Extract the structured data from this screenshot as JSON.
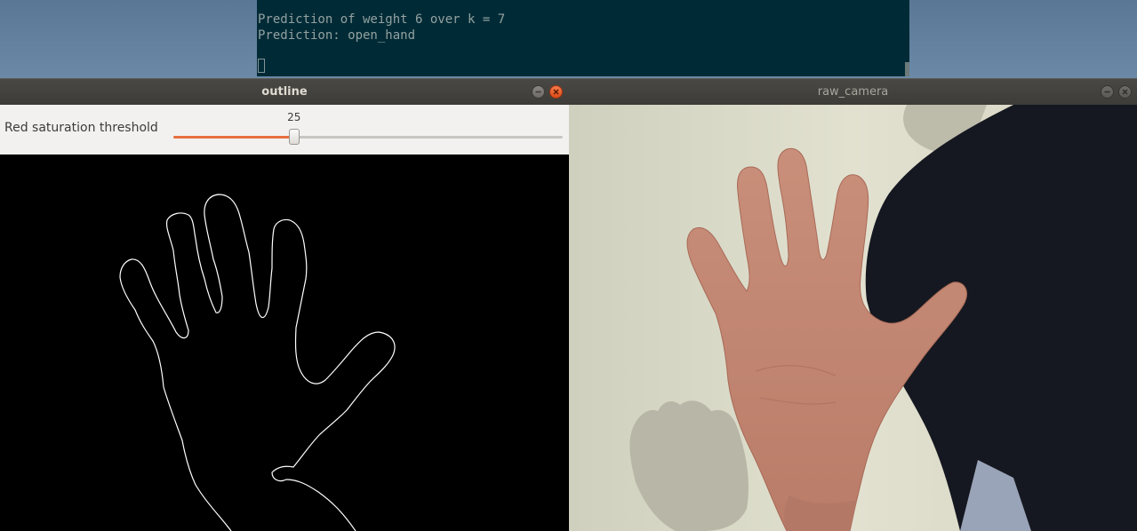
{
  "terminal": {
    "lines": [
      "Prediction of weight 6 over k = 7",
      "Prediction: open_hand"
    ]
  },
  "outline_window": {
    "title": "outline",
    "slider": {
      "label": "Red saturation threshold",
      "value": "25",
      "fraction": 0.31
    }
  },
  "camera_window": {
    "title": "raw_camera"
  },
  "colors": {
    "terminal_bg": "#002b36",
    "terminal_text": "#93a1a1",
    "titlebar": "#3d3c38",
    "slider_accent": "#e8703f",
    "close_button": "#df4b16"
  }
}
